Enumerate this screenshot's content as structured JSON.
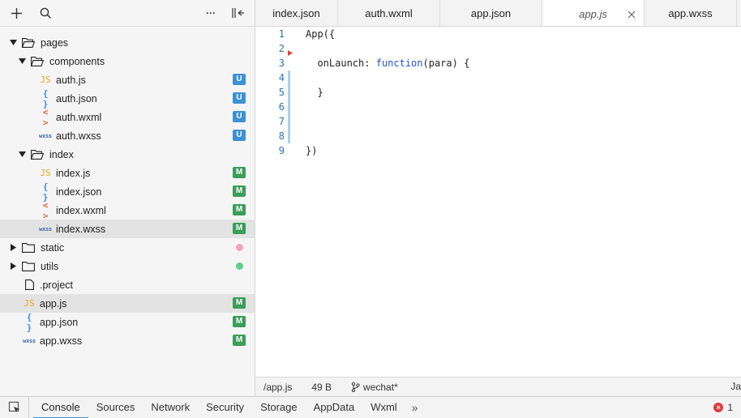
{
  "sidebar": {
    "toolbar": {
      "add_icon": "plus-icon",
      "search_icon": "search-icon",
      "more_label": "···",
      "collapse_icon": "collapse-sidebar-icon"
    },
    "tree": [
      {
        "type": "folder",
        "name": "pages",
        "level": 0,
        "expanded": true
      },
      {
        "type": "folder",
        "name": "components",
        "level": 1,
        "expanded": true
      },
      {
        "type": "file",
        "name": "auth.js",
        "level": 2,
        "icon": "JS",
        "kind": "js",
        "badge": "U"
      },
      {
        "type": "file",
        "name": "auth.json",
        "level": 2,
        "icon": "{ }",
        "kind": "json",
        "badge": "U"
      },
      {
        "type": "file",
        "name": "auth.wxml",
        "level": 2,
        "icon": "< >",
        "kind": "wxml",
        "badge": "U"
      },
      {
        "type": "file",
        "name": "auth.wxss",
        "level": 2,
        "icon": "wxss",
        "kind": "wxss",
        "badge": "U"
      },
      {
        "type": "folder",
        "name": "index",
        "level": 1,
        "expanded": true
      },
      {
        "type": "file",
        "name": "index.js",
        "level": 2,
        "icon": "JS",
        "kind": "js",
        "badge": "M"
      },
      {
        "type": "file",
        "name": "index.json",
        "level": 2,
        "icon": "{ }",
        "kind": "json",
        "badge": "M"
      },
      {
        "type": "file",
        "name": "index.wxml",
        "level": 2,
        "icon": "< >",
        "kind": "wxml",
        "badge": "M"
      },
      {
        "type": "file",
        "name": "index.wxss",
        "level": 2,
        "icon": "wxss",
        "kind": "wxss",
        "badge": "M",
        "selected": true
      },
      {
        "type": "folder",
        "name": "static",
        "level": 0,
        "expanded": false,
        "dot": "#f4a3bf"
      },
      {
        "type": "folder",
        "name": "utils",
        "level": 0,
        "expanded": false,
        "dot": "#5ccf8a"
      },
      {
        "type": "file",
        "name": ".project",
        "level": 0,
        "icon": "",
        "kind": "generic"
      },
      {
        "type": "file",
        "name": "app.js",
        "level": 0,
        "icon": "JS",
        "kind": "js",
        "badge": "M",
        "selected": true
      },
      {
        "type": "file",
        "name": "app.json",
        "level": 0,
        "icon": "{ }",
        "kind": "json",
        "badge": "M"
      },
      {
        "type": "file",
        "name": "app.wxss",
        "level": 0,
        "icon": "wxss",
        "kind": "wxss",
        "badge": "M"
      }
    ]
  },
  "tabs": [
    {
      "label": "index.json",
      "active": false
    },
    {
      "label": "auth.wxml",
      "active": false
    },
    {
      "label": "app.json",
      "active": false
    },
    {
      "label": "app.js",
      "active": true
    },
    {
      "label": "app.wxss",
      "active": false
    }
  ],
  "editor": {
    "lines": [
      {
        "num": "1",
        "code": [
          {
            "t": "App({"
          }
        ]
      },
      {
        "num": "2",
        "code": [],
        "marker": true
      },
      {
        "num": "3",
        "code": [
          {
            "t": "  onLaunch: "
          },
          {
            "t": "function",
            "kw": true
          },
          {
            "t": "(para) {"
          }
        ]
      },
      {
        "num": "4",
        "code": [],
        "modified": true
      },
      {
        "num": "5",
        "code": [
          {
            "t": "  }"
          }
        ],
        "modified": true
      },
      {
        "num": "6",
        "code": [],
        "modified": true
      },
      {
        "num": "7",
        "code": [],
        "modified": true
      },
      {
        "num": "8",
        "code": [],
        "modified": true
      },
      {
        "num": "9",
        "code": [
          {
            "t": "})"
          }
        ]
      }
    ]
  },
  "statusbar": {
    "path": "/app.js",
    "size": "49 B",
    "branch": "wechat*",
    "language": "Ja"
  },
  "devtools": {
    "tabs": [
      "Console",
      "Sources",
      "Network",
      "Security",
      "Storage",
      "AppData",
      "Wxml"
    ],
    "active": "Console",
    "more": "»",
    "error_count": "1"
  },
  "colors": {
    "badge_untracked": "#3c91d5",
    "badge_modified": "#3a9d58",
    "keyword": "#2456c8",
    "line_number": "#2b73b4",
    "modified_bar": "#a6d3ec"
  }
}
